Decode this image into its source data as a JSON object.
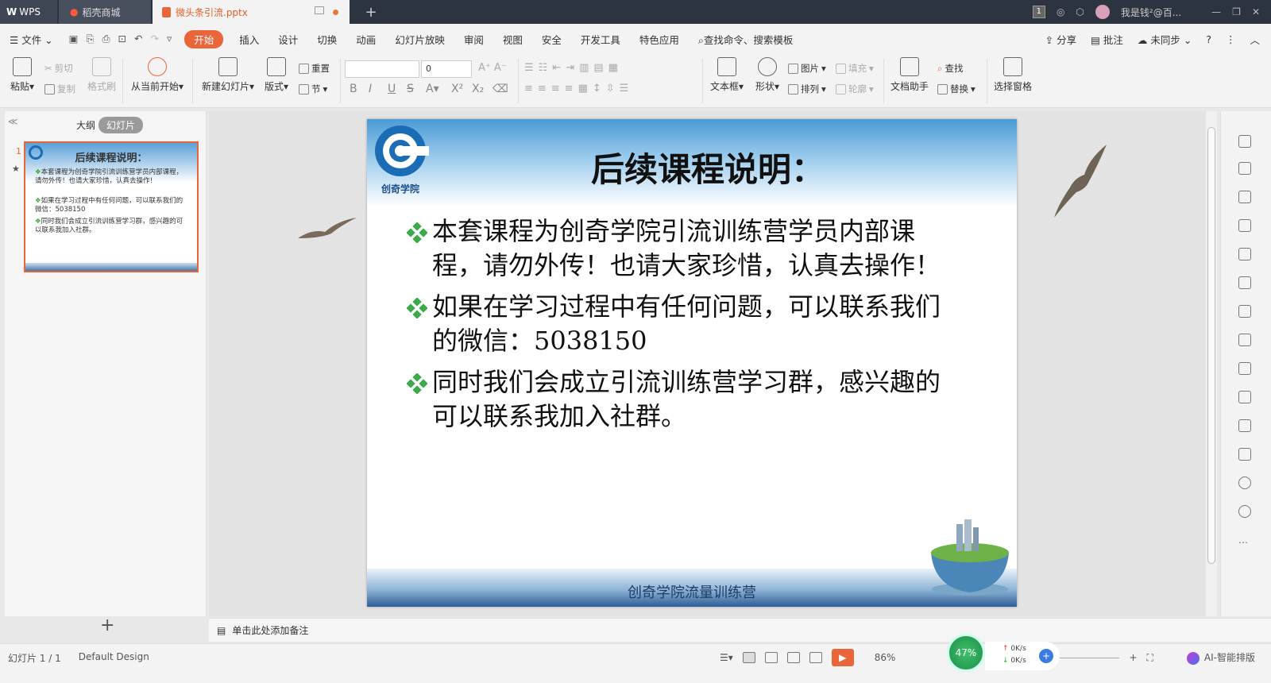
{
  "tabs": {
    "wps": "WPS",
    "daoke": "稻壳商城",
    "document": "微头条引流.pptx",
    "add": "+"
  },
  "titlebar": {
    "badge": "1",
    "user": "我是钱²@百..."
  },
  "menu": {
    "file": "文件",
    "items": [
      "开始",
      "插入",
      "设计",
      "切换",
      "动画",
      "幻灯片放映",
      "审阅",
      "视图",
      "安全",
      "开发工具",
      "特色应用"
    ],
    "search": "查找命令、搜索模板",
    "share": "分享",
    "comment": "批注",
    "sync": "未同步"
  },
  "ribbon": {
    "paste": "粘贴",
    "cut": "剪切",
    "copy": "复制",
    "format_painter": "格式刷",
    "from_current": "从当前开始",
    "new_slide": "新建幻灯片",
    "layout": "版式",
    "reset": "重置",
    "section": "节",
    "font_size": "0",
    "textbox": "文本框",
    "shape": "形状",
    "picture": "图片",
    "fill": "填充",
    "arrange": "排列",
    "outline": "轮廓",
    "doc_assistant": "文档助手",
    "find": "查找",
    "replace": "替换",
    "selection_pane": "选择窗格"
  },
  "panel": {
    "outline_tab": "大纲",
    "slides_tab": "幻灯片",
    "thumb_number": "1"
  },
  "slide": {
    "title": "后续课程说明：",
    "logo_text": "创奇学院",
    "bullets": [
      "本套课程为创奇学院引流训练营学员内部课程，请勿外传！也请大家珍惜，认真去操作！",
      "如果在学习过程中有任何问题，可以联系我们的微信：5038150",
      "同时我们会成立引流训练营学习群，感兴趣的可以联系我加入社群。"
    ],
    "footer": "创奇学院流量训练营"
  },
  "notes": {
    "placeholder": "单击此处添加备注"
  },
  "status": {
    "slide_count": "幻灯片 1 / 1",
    "theme": "Default Design",
    "zoom": "86%",
    "perf": "47%",
    "net_up": "0K/s",
    "net_down": "0K/s",
    "ai": "AI-智能排版"
  },
  "colors": {
    "accent": "#e8663a",
    "titlebar": "#2c3440"
  }
}
